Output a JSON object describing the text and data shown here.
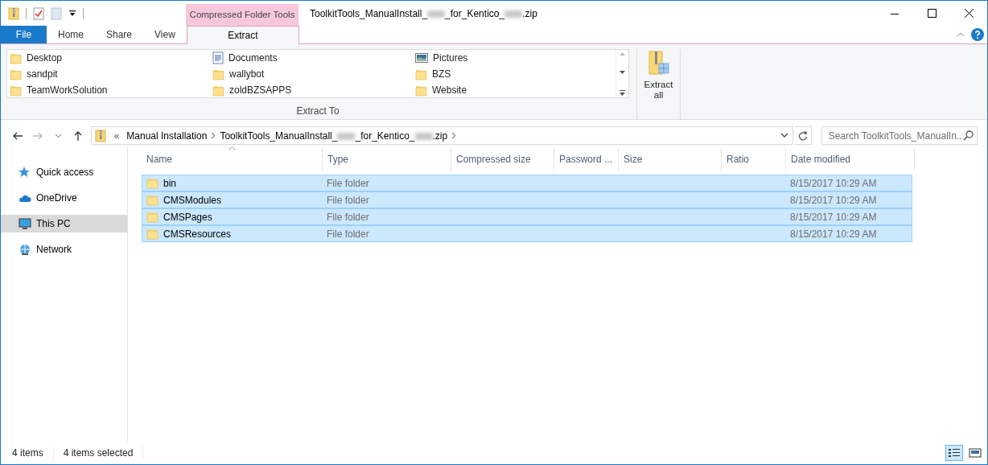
{
  "window": {
    "title_parts": [
      {
        "kind": "text",
        "text": "ToolkitTools_ManualInstall_"
      },
      {
        "kind": "redacted"
      },
      {
        "kind": "text",
        "text": "_for_Kentico_"
      },
      {
        "kind": "redacted"
      },
      {
        "kind": "text",
        "text": ".zip"
      }
    ],
    "context_tab_group": "Compressed Folder Tools"
  },
  "ribbon": {
    "tabs": [
      {
        "label": "File",
        "kind": "file",
        "selected": false
      },
      {
        "label": "Home",
        "kind": "tab",
        "selected": false
      },
      {
        "label": "Share",
        "kind": "tab",
        "selected": false
      },
      {
        "label": "View",
        "kind": "tab",
        "selected": false
      },
      {
        "label": "Extract",
        "kind": "context",
        "selected": true
      }
    ],
    "destinations": [
      {
        "label": "Desktop",
        "kind": "folder"
      },
      {
        "label": "sandpit",
        "kind": "folder"
      },
      {
        "label": "TeamWorkSolution",
        "kind": "folder"
      },
      {
        "label": "Documents",
        "kind": "documents"
      },
      {
        "label": "wallybot",
        "kind": "folder"
      },
      {
        "label": "zoldBZSAPPS",
        "kind": "folder"
      },
      {
        "label": "Pictures",
        "kind": "pictures"
      },
      {
        "label": "BZS",
        "kind": "folder"
      },
      {
        "label": "Website",
        "kind": "folder"
      }
    ],
    "group_label": "Extract To",
    "extract_all": "Extract all"
  },
  "address": {
    "crumbs": [
      "Manual Installation",
      {
        "parts": [
          {
            "kind": "text",
            "text": "ToolkitTools_ManualInstall_"
          },
          {
            "kind": "redacted"
          },
          {
            "kind": "text",
            "text": "_for_Kentico_"
          },
          {
            "kind": "redacted"
          },
          {
            "kind": "text",
            "text": ".zip"
          }
        ]
      }
    ],
    "overflow": "«",
    "search_placeholder": "Search ToolkitTools_ManualIn..."
  },
  "sidebar": {
    "items": [
      {
        "label": "Quick access",
        "kind": "star",
        "selected": false
      },
      {
        "label": "OneDrive",
        "kind": "cloud",
        "selected": false
      },
      {
        "label": "This PC",
        "kind": "pc",
        "selected": true
      },
      {
        "label": "Network",
        "kind": "network",
        "selected": false
      }
    ]
  },
  "table": {
    "columns": [
      "Name",
      "Type",
      "Compressed size",
      "Password ...",
      "Size",
      "Ratio",
      "Date modified"
    ],
    "rows": [
      {
        "name": "bin",
        "type": "File folder",
        "date": "8/15/2017 10:29 AM",
        "selected": true
      },
      {
        "name": "CMSModules",
        "type": "File folder",
        "date": "8/15/2017 10:29 AM",
        "selected": true
      },
      {
        "name": "CMSPages",
        "type": "File folder",
        "date": "8/15/2017 10:29 AM",
        "selected": true
      },
      {
        "name": "CMSResources",
        "type": "File folder",
        "date": "8/15/2017 10:29 AM",
        "selected": true
      }
    ]
  },
  "status_bar": {
    "item_count": "4 items",
    "selection": "4 items selected"
  }
}
